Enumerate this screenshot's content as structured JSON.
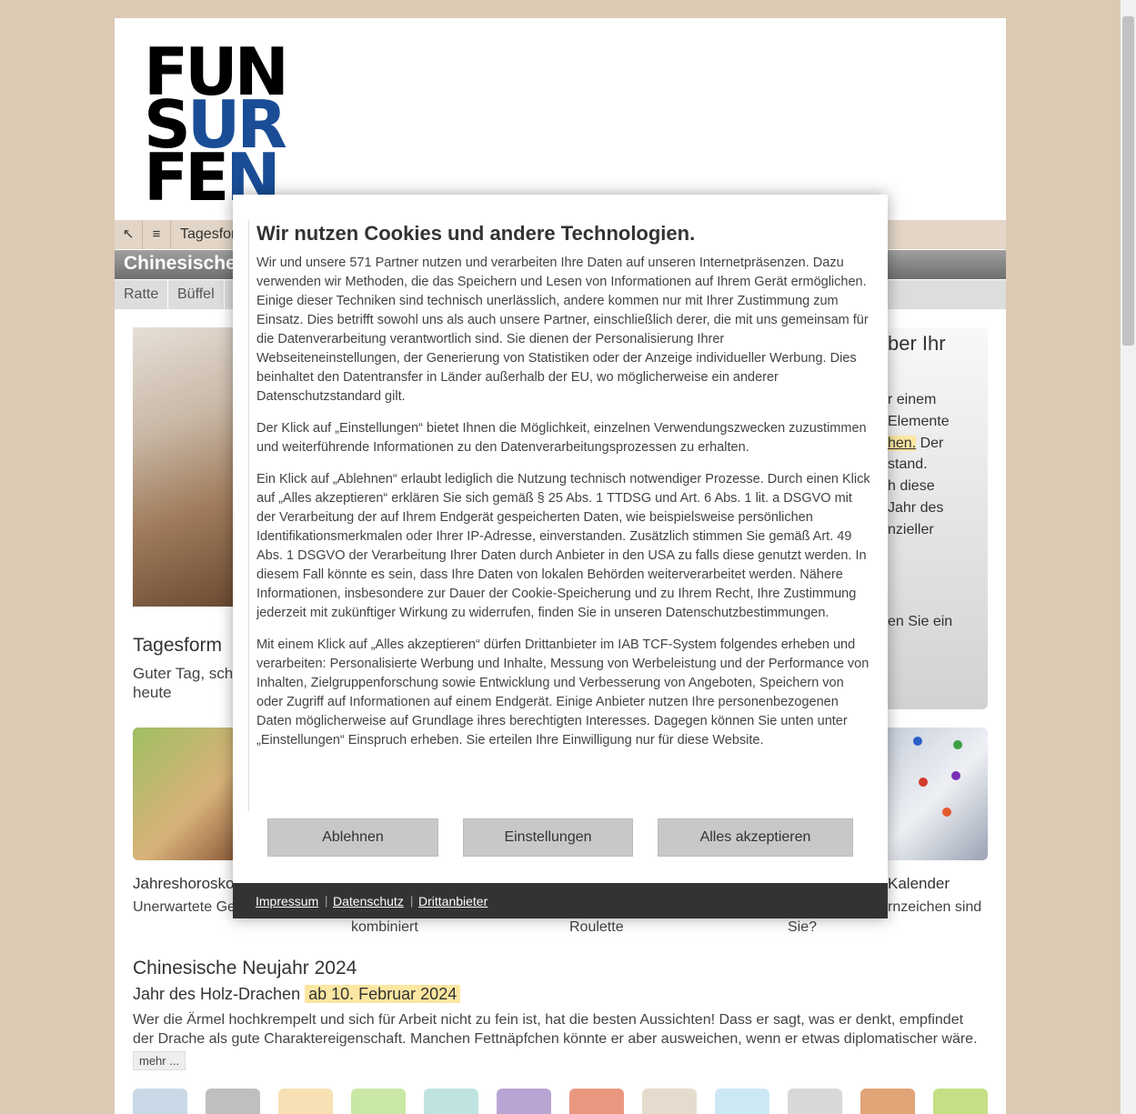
{
  "logo": {
    "l1a": "FUN",
    "l2a": "S",
    "l2b": "UR",
    "l3a": "FE",
    "l3b": "N"
  },
  "nav": {
    "back_glyph": "↖",
    "menu_glyph": "≡",
    "current": "Tagesform"
  },
  "title_bar": "Chinesische",
  "animals": [
    "Ratte",
    "Büffel"
  ],
  "sidebar": {
    "line1": "ber Ihr",
    "t1": "r einem",
    "t2": "Elemente",
    "t3": "hen.",
    "t3b": "Der",
    "t4": "stand.",
    "t5": "h diese",
    "t6": "Jahr des",
    "t7": "nzieller",
    "t8": "en Sie ein"
  },
  "tagesform": {
    "heading": "Tagesform",
    "text": "Guter Tag, sch heute"
  },
  "jahreshoroskop": {
    "heading": "Jahreshorosko",
    "text": "Unerwartete Ge"
  },
  "kalender": {
    "heading": "Kalender",
    "text": "rnzeichen sind"
  },
  "captions": {
    "c1": "kombiniert",
    "c2": "Roulette",
    "c3": "Sie?"
  },
  "neujahr": {
    "heading": "Chinesische Neujahr 2024",
    "subtitle": "Jahr des Holz-Drachen",
    "date": "ab 10. Februar 2024",
    "text": "Wer die Ärmel hochkrempelt und sich für Arbeit nicht zu fein ist, hat die besten Aussichten! Dass er sagt, was er denkt, empfindet der Drache als gute Charaktereigenschaft. Manchen Fettnäpfchen könnte er aber ausweichen, wenn er etwas diplomatischer wäre.",
    "more": "mehr ..."
  },
  "zodiac_colors": [
    "#c9d8e6",
    "#bfbfbf",
    "#f6e0b4",
    "#c9e8a5",
    "#bfe3e0",
    "#b9a5d4",
    "#e9987f",
    "#e5dccd",
    "#cde8f5",
    "#d8d8d8",
    "#e0a477",
    "#c4e084"
  ],
  "cookie": {
    "title": "Wir nutzen Cookies und andere Technologien.",
    "p1": "Wir und unsere 571 Partner nutzen und verarbeiten Ihre Daten auf unseren Internetpräsenzen. Dazu verwenden wir Methoden, die das Speichern und Lesen von Informationen auf Ihrem Gerät ermöglichen. Einige dieser Techniken sind technisch unerlässlich, andere kommen nur mit Ihrer Zustimmung zum Einsatz. Dies betrifft sowohl uns als auch unsere Partner, einschließlich derer, die mit uns gemeinsam für die Datenverarbeitung verantwortlich sind. Sie dienen der Personalisierung Ihrer Webseiteneinstellungen, der Generierung von Statistiken oder der Anzeige individueller Werbung. Dies beinhaltet den Datentransfer in Länder außerhalb der EU, wo möglicherweise ein anderer Datenschutzstandard gilt.",
    "p2": "Der Klick auf „Einstellungen“ bietet Ihnen die Möglichkeit, einzelnen Verwendungszwecken zuzustimmen und weiterführende Informationen zu den Datenverarbeitungsprozessen zu erhalten.",
    "p3": "Ein Klick auf „Ablehnen“ erlaubt lediglich die Nutzung technisch notwendiger Prozesse. Durch einen Klick auf „Alles akzeptieren“ erklären Sie sich gemäß § 25 Abs. 1 TTDSG und Art. 6 Abs. 1 lit. a DSGVO mit der Verarbeitung der auf Ihrem Endgerät gespeicherten Daten, wie beispielsweise persönlichen Identifikationsmerkmalen oder Ihrer IP-Adresse, einverstanden. Zusätzlich stimmen Sie gemäß Art. 49 Abs. 1 DSGVO der Verarbeitung Ihrer Daten durch Anbieter in den USA zu falls diese genutzt werden. In diesem Fall könnte es sein, dass Ihre Daten von lokalen Behörden weiterverarbeitet werden. Nähere Informationen, insbesondere zur Dauer der Cookie-Speicherung und zu Ihrem Recht, Ihre Zustimmung jederzeit mit zukünftiger Wirkung zu widerrufen, finden Sie in unseren Datenschutzbestimmungen.",
    "p4": "Mit einem Klick auf „Alles akzeptieren“ dürfen Drittanbieter im IAB TCF-System folgendes erheben und verarbeiten: Personalisierte Werbung und Inhalte, Messung von Werbeleistung und der Performance von Inhalten, Zielgruppenforschung sowie Entwicklung und Verbesserung von Angeboten, Speichern von oder Zugriff auf Informationen auf einem Endgerät. Einige Anbieter nutzen Ihre personenbezogenen Daten möglicherweise auf Grundlage ihres berechtigten Interesses. Dagegen können Sie unten unter „Einstellungen“ Einspruch erheben. Sie erteilen Ihre Einwilligung nur für diese Website.",
    "btn_reject": "Ablehnen",
    "btn_settings": "Einstellungen",
    "btn_accept": "Alles akzeptieren",
    "footer": {
      "impressum": "Impressum",
      "datenschutz": "Datenschutz",
      "drittanbieter": "Drittanbieter",
      "sep": "|"
    }
  }
}
